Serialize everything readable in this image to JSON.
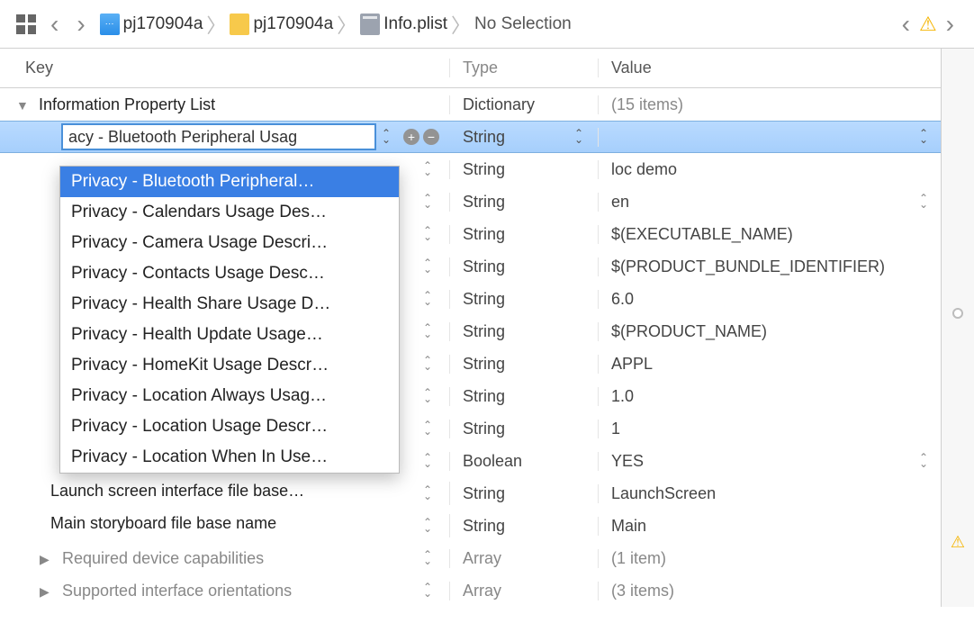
{
  "breadcrumb": {
    "project": "pj170904a",
    "folder": "pj170904a",
    "file": "Info.plist",
    "selection": "No Selection"
  },
  "columns": {
    "key": "Key",
    "type": "Type",
    "value": "Value"
  },
  "root": {
    "key": "Information Property List",
    "type": "Dictionary",
    "value": "(15 items)"
  },
  "editing": {
    "text": "acy - Bluetooth Peripheral Usag"
  },
  "rows": [
    {
      "key_visible": "",
      "type": "String",
      "value": ""
    },
    {
      "key_visible": "",
      "type": "String",
      "value": "loc demo"
    },
    {
      "key_visible": "",
      "type": "String",
      "value": "en"
    },
    {
      "key_visible": "",
      "type": "String",
      "value": "$(EXECUTABLE_NAME)"
    },
    {
      "key_visible": "",
      "type": "String",
      "value": "$(PRODUCT_BUNDLE_IDENTIFIER)"
    },
    {
      "key_visible": "",
      "type": "String",
      "value": "6.0"
    },
    {
      "key_visible": "",
      "type": "String",
      "value": "$(PRODUCT_NAME)"
    },
    {
      "key_visible": "",
      "type": "String",
      "value": "APPL"
    },
    {
      "key_visible": "",
      "type": "String",
      "value": "1.0"
    },
    {
      "key_visible": "",
      "type": "String",
      "value": "1"
    },
    {
      "key_visible": "",
      "type": "Boolean",
      "value": "YES"
    },
    {
      "key_visible": "Launch screen interface file base…",
      "type": "String",
      "value": "LaunchScreen"
    },
    {
      "key_visible": "Main storyboard file base name",
      "type": "String",
      "value": "Main"
    },
    {
      "key_visible": "Required device capabilities",
      "type": "Array",
      "value": "(1 item)",
      "arrow": true
    },
    {
      "key_visible": "Supported interface orientations",
      "type": "Array",
      "value": "(3 items)",
      "arrow": true
    }
  ],
  "dropdown": [
    "Privacy - Bluetooth Peripheral…",
    "Privacy - Calendars Usage Des…",
    "Privacy - Camera Usage Descri…",
    "Privacy - Contacts Usage Desc…",
    "Privacy - Health Share Usage D…",
    "Privacy - Health Update Usage…",
    "Privacy - HomeKit Usage Descr…",
    "Privacy - Location Always Usag…",
    "Privacy - Location Usage Descr…",
    "Privacy - Location When In Use…"
  ]
}
